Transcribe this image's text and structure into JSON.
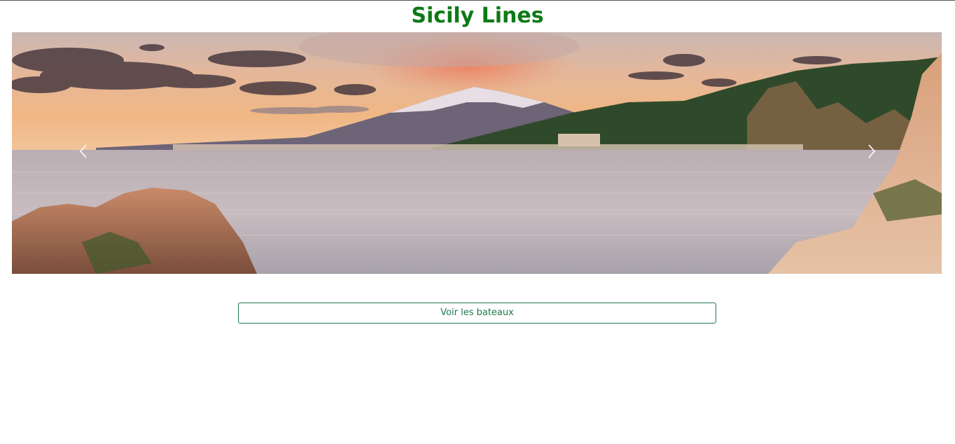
{
  "header": {
    "title": "Sicily Lines"
  },
  "carousel": {
    "prev_icon": "chevron-left-icon",
    "next_icon": "chevron-right-icon"
  },
  "actions": {
    "view_boats_label": "Voir les bateaux"
  },
  "colors": {
    "title": "#0b7a16",
    "button_border": "#1c7a4c",
    "button_text": "#1c7a4c"
  }
}
